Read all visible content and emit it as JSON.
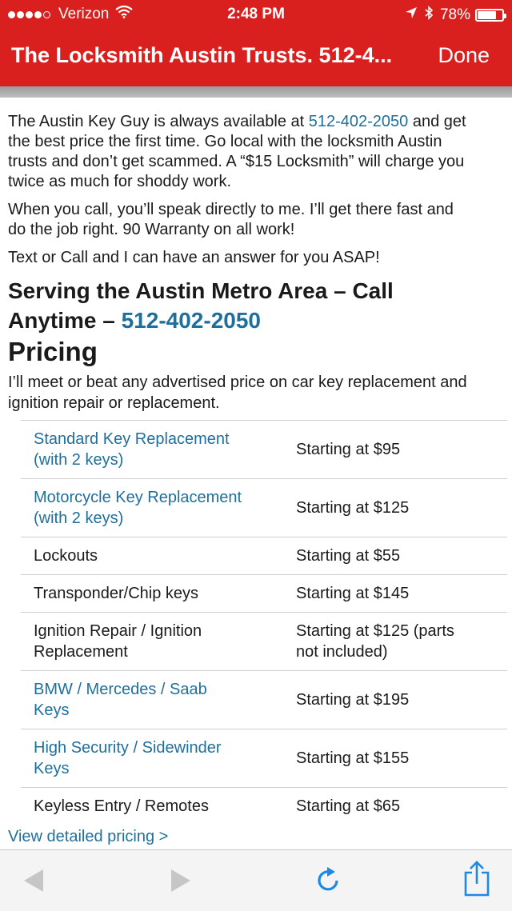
{
  "status_bar": {
    "carrier": "Verizon",
    "time": "2:48 PM",
    "battery_percent": "78%",
    "battery_level": 0.78,
    "signal_bars_filled": 4,
    "signal_bars_total": 5
  },
  "nav": {
    "title": "The Locksmith Austin Trusts. 512-4...",
    "done_label": "Done"
  },
  "content": {
    "para1": {
      "line1_a": "The Austin Key Guy is always available at ",
      "line1_phone": "512-402-2050",
      "line1_b": " and get",
      "line2": "the best price the first time. Go local with the locksmith Austin",
      "line3": "trusts and don’t get scammed. A “$15 Locksmith” will charge you",
      "line4": "twice as much for shoddy work."
    },
    "para2": {
      "line1": "When you call, you’ll speak directly to me. I’ll get there fast and",
      "line2": "do the job right. 90 Warranty on all work!"
    },
    "para3": "Text or Call and I can have an answer for you ASAP!",
    "serving_heading": {
      "line1": "Serving the Austin Metro Area – Call",
      "line2_a": "Anytime – ",
      "line2_phone": "512-402-2050"
    },
    "pricing_heading": "Pricing",
    "pricing_intro": {
      "line1": "I’ll meet or beat any advertised price on car key replacement and",
      "line2": "ignition repair or replacement."
    },
    "price_rows": [
      {
        "service_l1": "Standard Key Replacement",
        "service_l2": "(with 2 keys)",
        "price_l1": "Starting at $95",
        "price_l2": ""
      },
      {
        "service_l1": "Motorcycle Key Replacement",
        "service_l2": "(with 2 keys)",
        "price_l1": "Starting at $125",
        "price_l2": ""
      },
      {
        "service_l1": "Lockouts",
        "service_l2": "",
        "price_l1": "Starting at $55",
        "price_l2": ""
      },
      {
        "service_l1": "Transponder/Chip keys",
        "service_l2": "",
        "price_l1": "Starting at $145",
        "price_l2": ""
      },
      {
        "service_l1": "Ignition Repair / Ignition",
        "service_l2": "Replacement",
        "price_l1": "Starting at $125 (parts",
        "price_l2": "not included)"
      },
      {
        "service_l1": "BMW / Mercedes / Saab",
        "service_l2": "Keys",
        "price_l1": "Starting at $195",
        "price_l2": ""
      },
      {
        "service_l1": "High Security / Sidewinder",
        "service_l2": "Keys",
        "price_l1": "Starting at $155",
        "price_l2": ""
      },
      {
        "service_l1": "Keyless Entry / Remotes",
        "service_l2": "",
        "price_l1": "Starting at $65",
        "price_l2": ""
      }
    ],
    "detail_link": "View detailed pricing >"
  },
  "colors": {
    "chrome_red": "#d9201e",
    "link_blue": "#1f6f9c",
    "toolbar_blue": "#1e88e5"
  },
  "icons": {
    "back": "back-arrow-icon",
    "forward": "forward-arrow-icon",
    "refresh": "refresh-icon",
    "share": "share-icon"
  }
}
